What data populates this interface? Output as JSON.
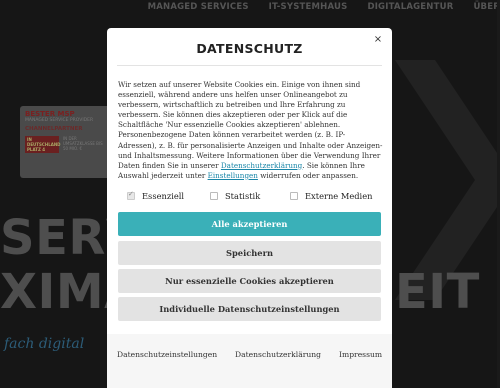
{
  "nav": {
    "items": [
      "MANAGED SERVICES",
      "IT-SYSTEMHAUS",
      "DIGITALAGENTUR",
      "ÜBER"
    ]
  },
  "background": {
    "award_title": "BESTER MSP",
    "award_sub": "MANAGED SERVICE PROVIDER",
    "award_brand": "CHANNELPARTNER",
    "award_tag": "IN DEUTSCHLAND PLATZ 4",
    "award_tiny": "IN DER UMSATZKLASSE BIS 50 MIO. €",
    "headline_1": "SERV",
    "headline_2": "XIMA",
    "headline_3": "EIT",
    "tagline": "fach digital"
  },
  "modal": {
    "title": "DATENSCHUTZ",
    "close_label": "×",
    "body_before_link1": "Wir setzen auf unserer Website Cookies ein. Einige von ihnen sind essenziell, während andere uns helfen unser Onlineangebot zu verbessern, wirtschaftlich zu betreiben und Ihre Erfahrung zu verbessern. Sie können dies akzeptieren oder per Klick auf die Schaltfläche 'Nur essenzielle Cookies akzeptieren' ablehnen. Personenbezogene Daten können verarbeitet werden (z. B. IP-Adressen), z. B. für personalisierte Anzeigen und Inhalte oder Anzeigen- und Inhaltsmessung. Weitere Informationen über die Verwendung Ihrer Daten finden Sie in unserer ",
    "link1": "Datenschutzerklärung",
    "body_between_links": ". Sie können Ihre Auswahl jederzeit unter ",
    "link2": "Einstellungen",
    "body_after_link2": " widerrufen oder anpassen.",
    "checkboxes": [
      {
        "label": "Essenziell",
        "checked": true
      },
      {
        "label": "Statistik",
        "checked": false
      },
      {
        "label": "Externe Medien",
        "checked": false
      }
    ],
    "buttons": {
      "accept_all": "Alle akzeptieren",
      "save": "Speichern",
      "essential_only": "Nur essenzielle Cookies akzeptieren",
      "individual": "Individuelle Datenschutzeinstellungen"
    },
    "footer_links": [
      "Datenschutzeinstellungen",
      "Datenschutzerklärung",
      "Impressum"
    ]
  },
  "colors": {
    "accent": "#3ab0b8",
    "link": "#1a86a8",
    "overlay": "#161616"
  }
}
